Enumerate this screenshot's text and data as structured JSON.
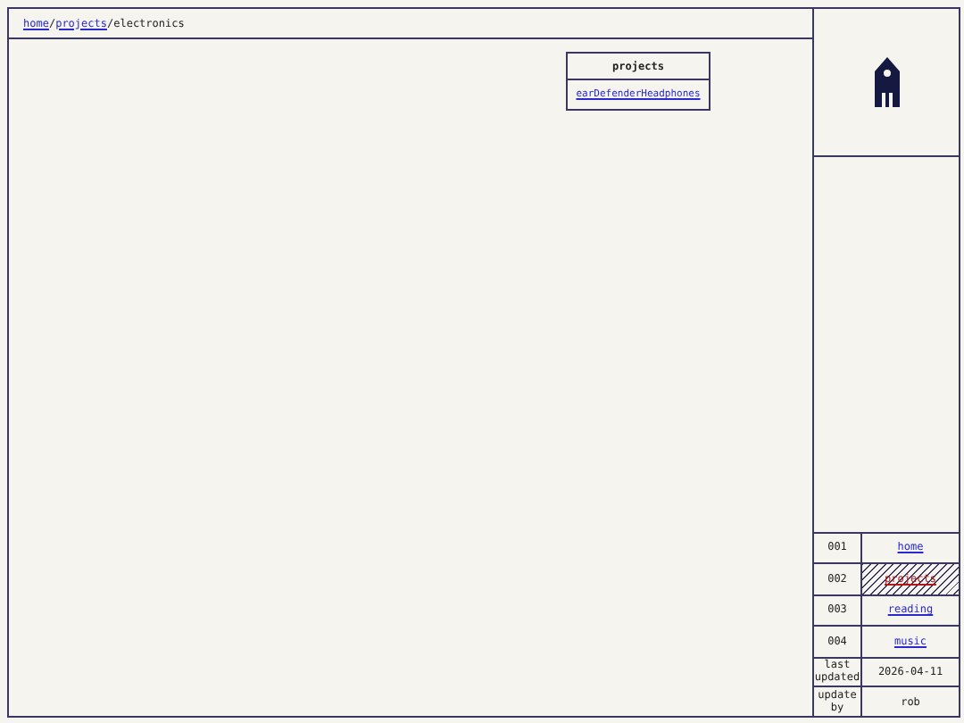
{
  "breadcrumb": [
    {
      "text": "home",
      "kind": "link"
    },
    {
      "text": "/",
      "kind": "sep"
    },
    {
      "text": "projects",
      "kind": "link"
    },
    {
      "text": "/",
      "kind": "sep"
    },
    {
      "text": "electronics",
      "kind": "current"
    }
  ],
  "projects_box": {
    "title": "projects",
    "items": [
      "earDefenderHeadphones"
    ]
  },
  "nav": [
    {
      "number": "001",
      "label": "home",
      "selected": false
    },
    {
      "number": "002",
      "label": "projects",
      "selected": true
    },
    {
      "number": "003",
      "label": "reading",
      "selected": false
    },
    {
      "number": "004",
      "label": "music",
      "selected": false
    }
  ],
  "meta": [
    {
      "label": "last updated",
      "value": "2026-04-11"
    },
    {
      "label": "update by",
      "value": "rob"
    }
  ]
}
